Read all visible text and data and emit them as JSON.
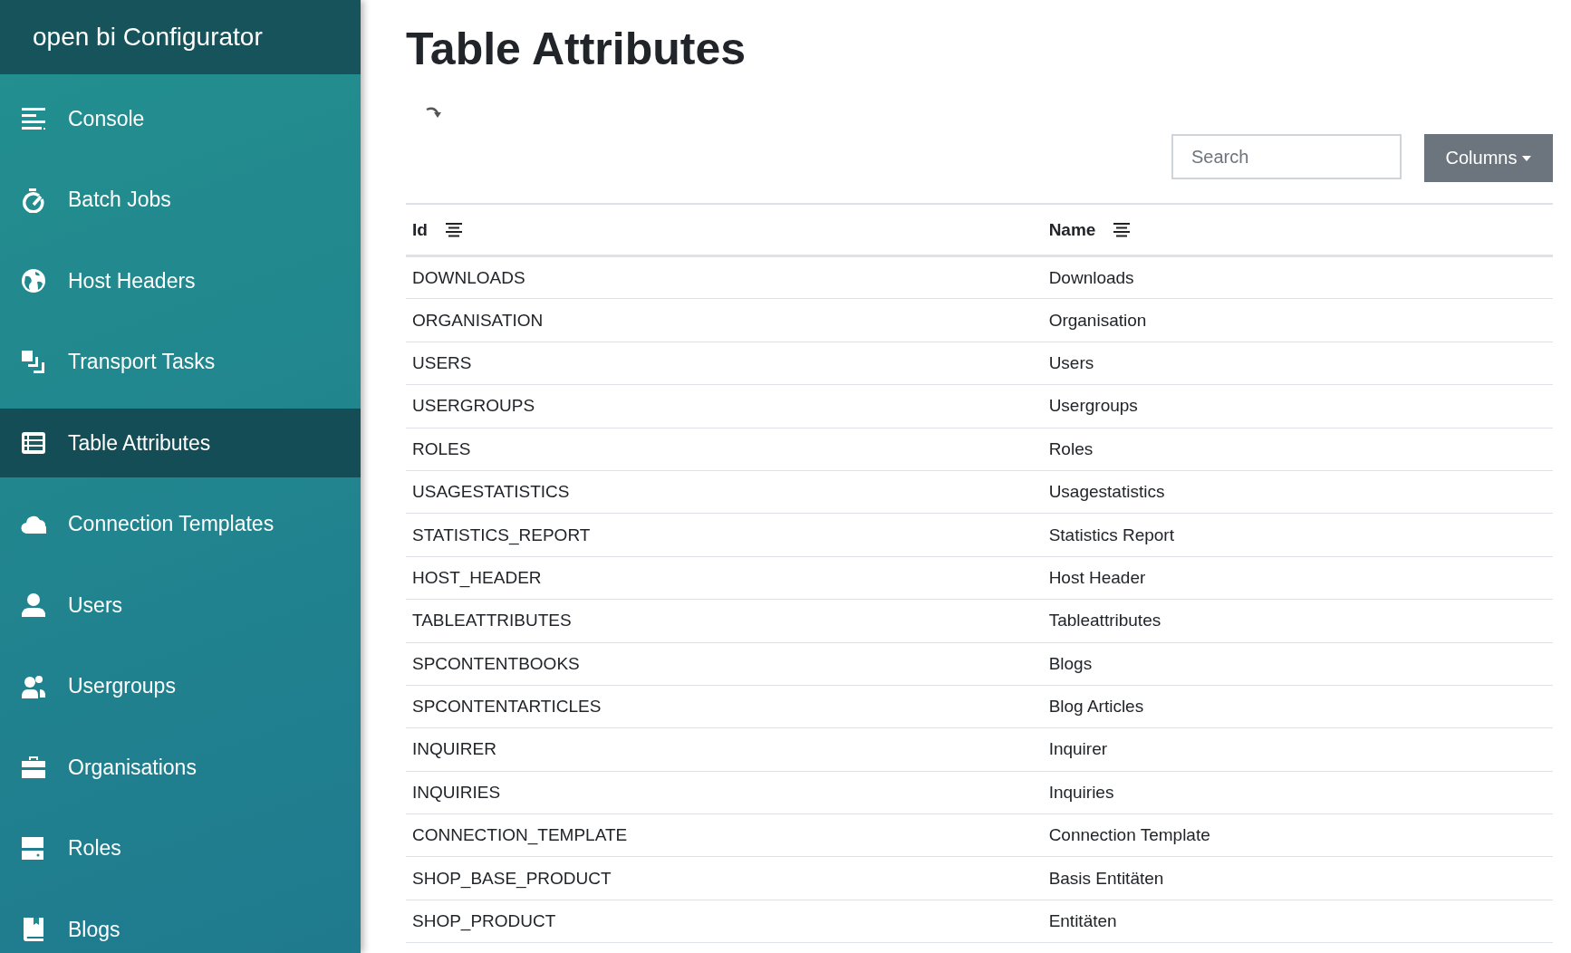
{
  "sidebar": {
    "brand": "open bi Configurator",
    "items": [
      {
        "label": "Console",
        "selected": false
      },
      {
        "label": "Batch Jobs",
        "selected": false
      },
      {
        "label": "Host Headers",
        "selected": false
      },
      {
        "label": "Transport Tasks",
        "selected": false
      },
      {
        "label": "Table Attributes",
        "selected": true
      },
      {
        "label": "Connection Templates",
        "selected": false
      },
      {
        "label": "Users",
        "selected": false
      },
      {
        "label": "Usergroups",
        "selected": false
      },
      {
        "label": "Organisations",
        "selected": false
      },
      {
        "label": "Roles",
        "selected": false
      },
      {
        "label": "Blogs",
        "selected": false
      }
    ]
  },
  "page": {
    "title": "Table Attributes"
  },
  "toolbar": {
    "search": {
      "placeholder": "Search"
    },
    "columns_button": "Columns"
  },
  "table": {
    "columns": [
      "Id",
      "Name"
    ],
    "rows": [
      [
        "DOWNLOADS",
        "Downloads"
      ],
      [
        "ORGANISATION",
        "Organisation"
      ],
      [
        "USERS",
        "Users"
      ],
      [
        "USERGROUPS",
        "Usergroups"
      ],
      [
        "ROLES",
        "Roles"
      ],
      [
        "USAGESTATISTICS",
        "Usagestatistics"
      ],
      [
        "STATISTICS_REPORT",
        "Statistics Report"
      ],
      [
        "HOST_HEADER",
        "Host Header"
      ],
      [
        "TABLEATTRIBUTES",
        "Tableattributes"
      ],
      [
        "SPCONTENTBOOKS",
        "Blogs"
      ],
      [
        "SPCONTENTARTICLES",
        "Blog Articles"
      ],
      [
        "INQUIRER",
        "Inquirer"
      ],
      [
        "INQUIRIES",
        "Inquiries"
      ],
      [
        "CONNECTION_TEMPLATE",
        "Connection Template"
      ],
      [
        "SHOP_BASE_PRODUCT",
        "Basis Entitäten"
      ],
      [
        "SHOP_PRODUCT",
        "Entitäten"
      ]
    ]
  }
}
